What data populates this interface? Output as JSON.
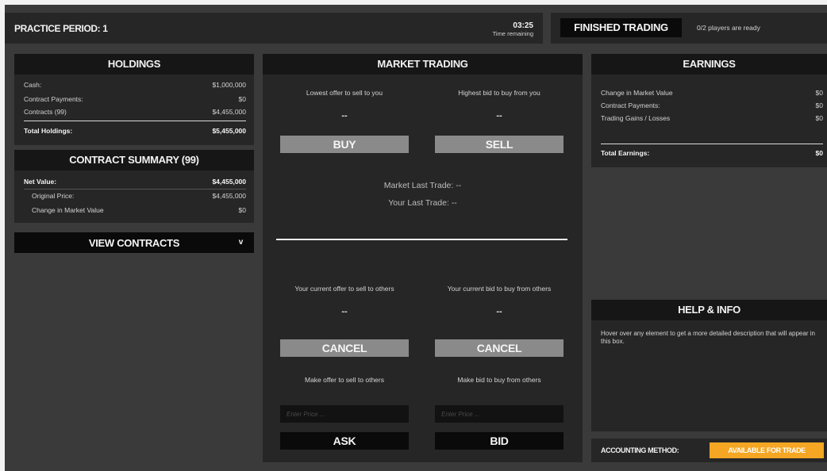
{
  "topbar": {
    "period_label": "PRACTICE PERIOD: 1",
    "time": "03:25",
    "time_label": "Time remaining",
    "finished_button": "FINISHED TRADING",
    "players_ready": "0/2 players are ready"
  },
  "holdings": {
    "title": "HOLDINGS",
    "rows": [
      {
        "label": "Cash:",
        "value": "$1,000,000"
      },
      {
        "label": "Contract Payments:",
        "value": "$0"
      },
      {
        "label": "Contracts (99)",
        "value": "$4,455,000"
      }
    ],
    "total_label": "Total Holdings:",
    "total_value": "$5,455,000"
  },
  "contract_summary": {
    "title": "CONTRACT SUMMARY (99)",
    "net_label": "Net Value:",
    "net_value": "$4,455,000",
    "rows": [
      {
        "label": "Original Price:",
        "value": "$4,455,000"
      },
      {
        "label": "Change in Market Value",
        "value": "$0"
      }
    ]
  },
  "view_contracts": {
    "label": "VIEW CONTRACTS",
    "chevron": "v"
  },
  "market": {
    "title": "MARKET TRADING",
    "lowest_offer_label": "Lowest offer to sell to you",
    "highest_bid_label": "Highest bid to buy from you",
    "lowest_offer_value": "--",
    "highest_bid_value": "--",
    "buy_label": "BUY",
    "sell_label": "SELL",
    "market_last_trade": "Market Last Trade: --",
    "your_last_trade": "Your Last Trade: --",
    "current_offer_label": "Your current offer to sell to others",
    "current_bid_label": "Your current bid to buy from others",
    "current_offer_value": "--",
    "current_bid_value": "--",
    "cancel_offer_label": "CANCEL",
    "cancel_bid_label": "CANCEL",
    "make_offer_label": "Make offer to sell to others",
    "make_bid_label": "Make bid to buy from others",
    "offer_placeholder": "Enter Price ...",
    "bid_placeholder": "Enter Price ...",
    "ask_label": "ASK",
    "bid_label": "BID"
  },
  "earnings": {
    "title": "EARNINGS",
    "rows": [
      {
        "label": "Change in Market Value",
        "value": "$0"
      },
      {
        "label": "Contract Payments:",
        "value": "$0"
      },
      {
        "label": "Trading Gains / Losses",
        "value": "$0"
      }
    ],
    "total_label": "Total Earnings:",
    "total_value": "$0"
  },
  "help": {
    "title": "HELP & INFO",
    "text": "Hover over any element to get a more detailed description that will appear in this box."
  },
  "accounting": {
    "label": "ACCOUNTING METHOD:",
    "button": "AVAILABLE FOR TRADE",
    "button_color": "#f5a623"
  }
}
